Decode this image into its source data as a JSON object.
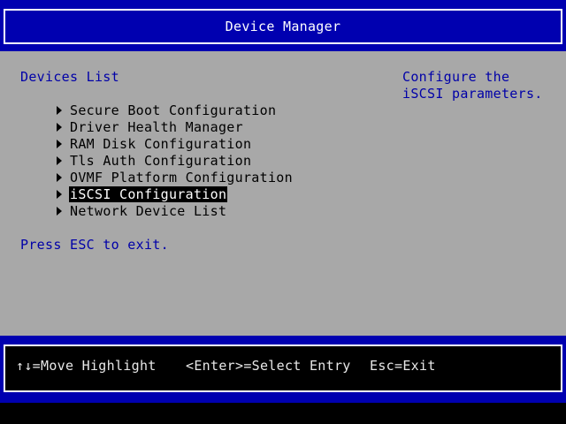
{
  "header": {
    "title": "Device Manager"
  },
  "menu": {
    "title": "Devices List",
    "items": [
      {
        "label": "Secure Boot Configuration",
        "selected": false
      },
      {
        "label": "Driver Health Manager",
        "selected": false
      },
      {
        "label": "RAM Disk Configuration",
        "selected": false
      },
      {
        "label": "Tls Auth Configuration",
        "selected": false
      },
      {
        "label": "OVMF Platform Configuration",
        "selected": false
      },
      {
        "label": "iSCSI Configuration",
        "selected": true
      },
      {
        "label": "Network Device List",
        "selected": false
      }
    ],
    "exit_hint": "Press ESC to exit."
  },
  "help": {
    "text": "Configure the iSCSI parameters."
  },
  "footer": {
    "move": "↑↓=Move Highlight",
    "select": "<Enter>=Select Entry",
    "exit": "Esc=Exit"
  },
  "colors": {
    "header_band": "#0000b0",
    "main_background": "#a8a8a8",
    "title_text": "#0000a8",
    "selected_background": "#000000",
    "selected_text": "#ffffff"
  }
}
